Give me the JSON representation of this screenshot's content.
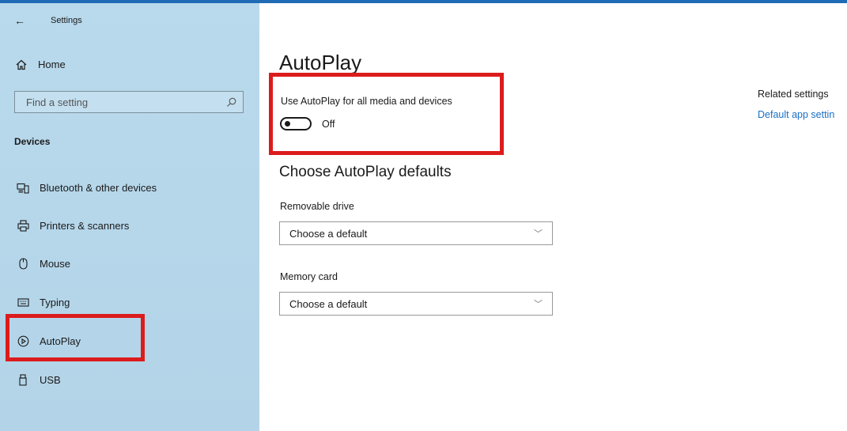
{
  "window": {
    "title": "Settings"
  },
  "sidebar": {
    "home_label": "Home",
    "search_placeholder": "Find a setting",
    "section_label": "Devices",
    "items": [
      {
        "label": "Bluetooth & other devices",
        "icon": "bluetooth-devices-icon"
      },
      {
        "label": "Printers & scanners",
        "icon": "printer-icon"
      },
      {
        "label": "Mouse",
        "icon": "mouse-icon"
      },
      {
        "label": "Typing",
        "icon": "keyboard-icon"
      },
      {
        "label": "AutoPlay",
        "icon": "autoplay-icon",
        "selected": true
      },
      {
        "label": "USB",
        "icon": "usb-icon"
      }
    ]
  },
  "main": {
    "title": "AutoPlay",
    "toggle": {
      "label": "Use AutoPlay for all media and devices",
      "state_text": "Off",
      "on": false
    },
    "defaults_heading": "Choose AutoPlay defaults",
    "removable": {
      "label": "Removable drive",
      "value": "Choose a default"
    },
    "memory_card": {
      "label": "Memory card",
      "value": "Choose a default"
    }
  },
  "related": {
    "title": "Related settings",
    "link": "Default app settin"
  },
  "colors": {
    "accent": "#1f6bb5",
    "highlight": "#dc1c1c",
    "link": "#1a6fc4",
    "sidebar": "#b9d9ec"
  }
}
